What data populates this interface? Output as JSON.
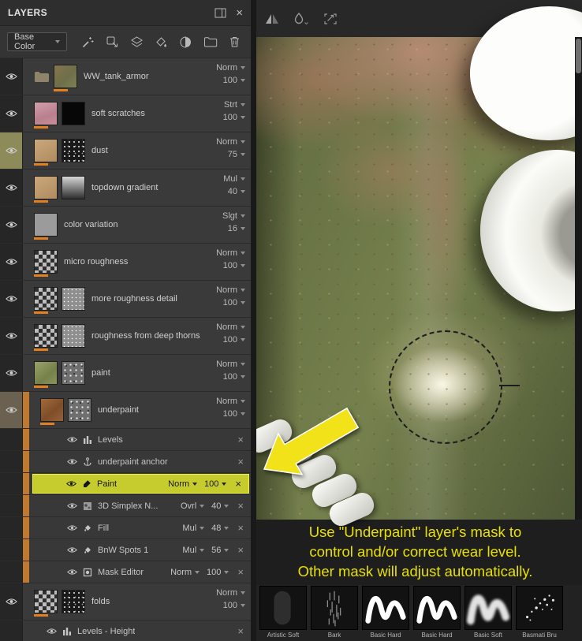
{
  "panel": {
    "title": "LAYERS",
    "channel_selector": {
      "value": "Base Color"
    },
    "toolbar_icons": [
      "wand-icon",
      "instantiate-icon",
      "fill-layer-icon",
      "bucket-icon",
      "smart-material-icon",
      "add-folder-icon",
      "trash-icon"
    ],
    "layers": [
      {
        "name": "WW_tank_armor",
        "blend": "Norm",
        "opacity": "100",
        "thumbs": [
          "folder",
          "armor"
        ]
      },
      {
        "name": "soft scratches",
        "blend": "Strt",
        "opacity": "100",
        "thumbs": [
          "pink",
          "black"
        ]
      },
      {
        "name": "dust",
        "blend": "Norm",
        "opacity": "75",
        "thumbs": [
          "tan",
          "speckle"
        ],
        "eye_bg": "#8d8b5a"
      },
      {
        "name": "topdown gradient",
        "blend": "Mul",
        "opacity": "40",
        "thumbs": [
          "tan",
          "gradient"
        ]
      },
      {
        "name": "color variation",
        "blend": "Slgt",
        "opacity": "16",
        "thumbs": [
          "gray"
        ]
      },
      {
        "name": "micro roughness",
        "blend": "Norm",
        "opacity": "100",
        "thumbs": [
          "checker"
        ]
      },
      {
        "name": "more roughness detail",
        "blend": "Norm",
        "opacity": "100",
        "thumbs": [
          "checker",
          "graymask"
        ]
      },
      {
        "name": "roughness from deep thorns",
        "blend": "Norm",
        "opacity": "100",
        "thumbs": [
          "checker",
          "graymask"
        ]
      },
      {
        "name": "paint",
        "blend": "Norm",
        "opacity": "100",
        "thumbs": [
          "green",
          "speckle2"
        ]
      },
      {
        "name": "underpaint",
        "blend": "Norm",
        "opacity": "100",
        "thumbs": [
          "rust",
          "speckle2"
        ],
        "eye_bg": "#6b6150",
        "color_strip": true,
        "effects": [
          {
            "name": "Levels",
            "icon": "levels"
          },
          {
            "name": "underpaint anchor",
            "icon": "anchor"
          },
          {
            "name": "Paint",
            "icon": "brush",
            "blend": "Norm",
            "opacity": "100",
            "selected": true
          },
          {
            "name": "3D Simplex N...",
            "icon": "proc",
            "blend": "Ovrl",
            "opacity": "40"
          },
          {
            "name": "Fill",
            "icon": "fill",
            "blend": "Mul",
            "opacity": "48"
          },
          {
            "name": "BnW Spots 1",
            "icon": "fill",
            "blend": "Mul",
            "opacity": "56"
          },
          {
            "name": "Mask Editor",
            "icon": "mask",
            "blend": "Norm",
            "opacity": "100"
          }
        ]
      },
      {
        "name": "folds",
        "blend": "Norm",
        "opacity": "100",
        "thumbs": [
          "checker",
          "speckle"
        ],
        "effects": [
          {
            "name": "Levels - Height",
            "icon": "levels"
          }
        ]
      }
    ]
  },
  "viewport": {
    "annotation_lines": [
      "Use \"Underpaint\" layer's mask to",
      "control and/or correct wear level.",
      "Other mask will adjust automatically."
    ],
    "annotation_color": "#e8e000",
    "brushes": [
      {
        "label": "Artistic Soft",
        "style": "faint"
      },
      {
        "label": "Bark",
        "style": "bark"
      },
      {
        "label": "Basic Hard",
        "style": "hard"
      },
      {
        "label": "Basic Hard",
        "style": "hard"
      },
      {
        "label": "Basic Soft",
        "style": "soft"
      },
      {
        "label": "Basmati Bru",
        "style": "spots"
      }
    ]
  },
  "colors": {
    "channel_accent_orange": "#e2801f",
    "group_strip_orange": "#bf7a30",
    "selection_yellow": "#c6cc2d",
    "dust_eye_highlight": "#8d8b5a"
  }
}
